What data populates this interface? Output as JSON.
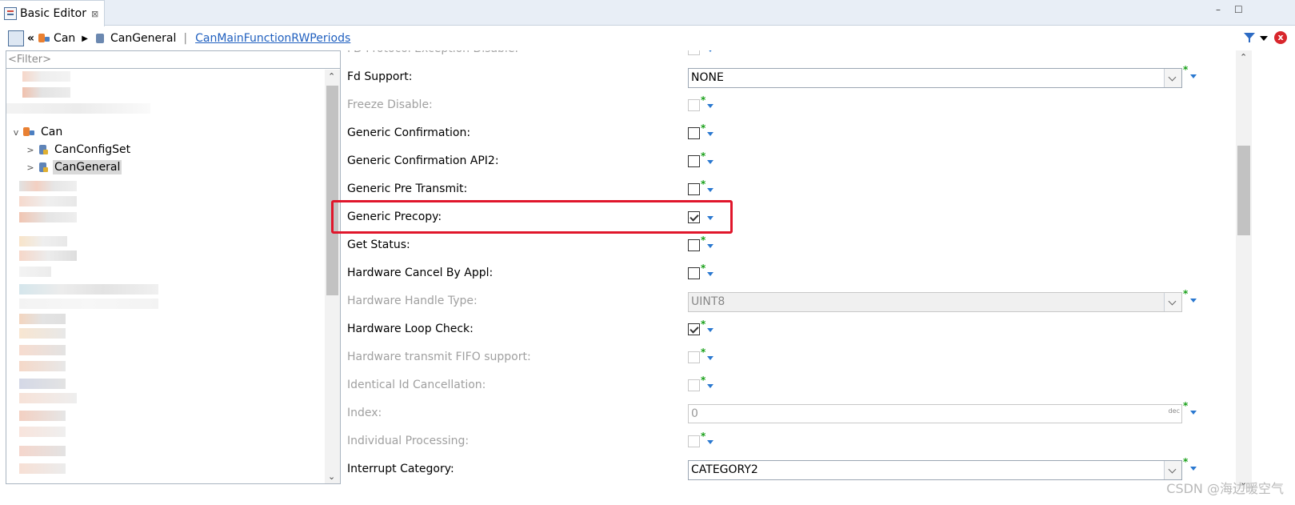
{
  "tab": {
    "title": "Basic Editor",
    "close": "⊠"
  },
  "window": {
    "minimize": "–",
    "maximize": "☐"
  },
  "breadcrumb": {
    "back": "«",
    "can": "Can",
    "arrow": "▶",
    "general": "CanGeneral",
    "sep": "|",
    "current": "CanMainFunctionRWPeriods"
  },
  "filter": {
    "placeholder": "<Filter>"
  },
  "tree": {
    "can": {
      "twisty": "v",
      "label": "Can"
    },
    "configset": {
      "twisty": ">",
      "label": "CanConfigSet"
    },
    "general": {
      "twisty": ">",
      "label": "CanGeneral"
    }
  },
  "properties": [
    {
      "label": "FD Protocol Exception Disable:",
      "type": "checkbox",
      "checked": false,
      "disabled": true,
      "star": false
    },
    {
      "label": "Fd Support:",
      "type": "combo",
      "value": "NONE",
      "disabled": false,
      "star": true
    },
    {
      "label": "Freeze Disable:",
      "type": "checkbox",
      "checked": false,
      "disabled": true,
      "star": true
    },
    {
      "label": "Generic Confirmation:",
      "type": "checkbox",
      "checked": false,
      "disabled": false,
      "star": true
    },
    {
      "label": "Generic Confirmation API2:",
      "type": "checkbox",
      "checked": false,
      "disabled": false,
      "star": true
    },
    {
      "label": "Generic Pre Transmit:",
      "type": "checkbox",
      "checked": false,
      "disabled": false,
      "star": true
    },
    {
      "label": "Generic Precopy:",
      "type": "checkbox",
      "checked": true,
      "disabled": false,
      "star": false
    },
    {
      "label": "Get Status:",
      "type": "checkbox",
      "checked": false,
      "disabled": false,
      "star": true
    },
    {
      "label": "Hardware Cancel By Appl:",
      "type": "checkbox",
      "checked": false,
      "disabled": false,
      "star": true
    },
    {
      "label": "Hardware Handle Type:",
      "type": "combo",
      "value": "UINT8",
      "disabled": true,
      "star": true
    },
    {
      "label": "Hardware Loop Check:",
      "type": "checkbox",
      "checked": true,
      "disabled": false,
      "star": true
    },
    {
      "label": "Hardware transmit FIFO support:",
      "type": "checkbox",
      "checked": false,
      "disabled": true,
      "star": true
    },
    {
      "label": "Identical Id Cancellation:",
      "type": "checkbox",
      "checked": false,
      "disabled": true,
      "star": true
    },
    {
      "label": "Index:",
      "type": "number",
      "value": "0",
      "unit": "dec",
      "disabled": true,
      "star": true
    },
    {
      "label": "Individual Processing:",
      "type": "checkbox",
      "checked": false,
      "disabled": true,
      "star": true
    },
    {
      "label": "Interrupt Category:",
      "type": "combo",
      "value": "CATEGORY2",
      "disabled": false,
      "star": true
    }
  ],
  "watermark": "CSDN @海边暖空气",
  "colors": {
    "highlight": "#e0162b",
    "star": "#18a018",
    "link": "#1f5fbf"
  }
}
